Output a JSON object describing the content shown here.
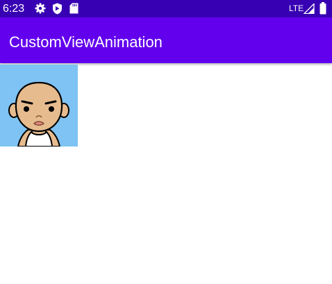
{
  "status_bar": {
    "time": "6:23",
    "network": "LTE",
    "icons": [
      "gear-icon",
      "shield-icon",
      "sd-card-icon",
      "signal-icon",
      "battery-icon"
    ],
    "background_color": "#3700B3"
  },
  "app_bar": {
    "title": "CustomViewAnimation",
    "background_color": "#6200EE"
  },
  "content": {
    "avatar": {
      "icon": "cartoon-man-avatar",
      "background_color": "#7EC3F3"
    }
  }
}
